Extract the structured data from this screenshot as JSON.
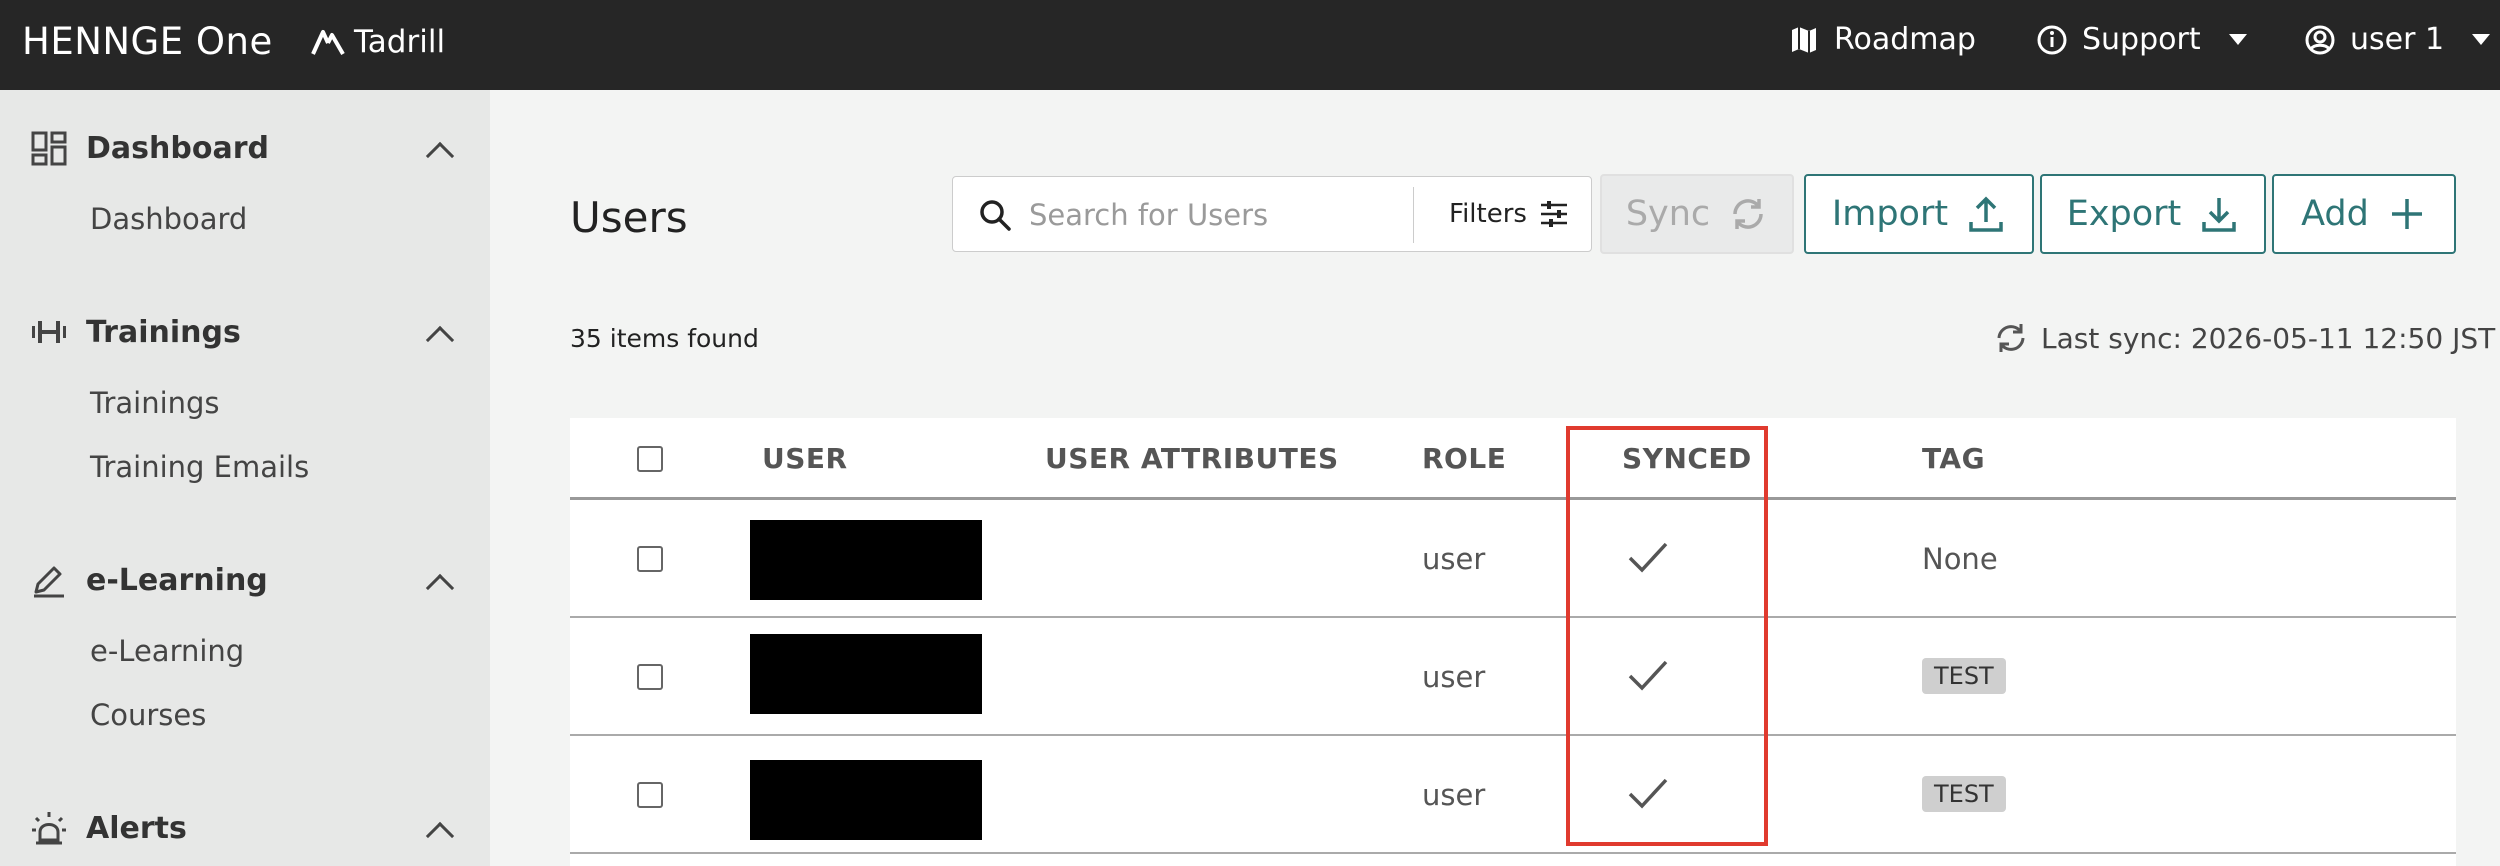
{
  "topbar": {
    "brand": "HENNGE One",
    "product": "Tadrill",
    "roadmap": "Roadmap",
    "support": "Support",
    "user": "user 1"
  },
  "sidebar": {
    "sections": [
      {
        "title": "Dashboard",
        "icon": "dashboard-icon",
        "items": [
          "Dashboard"
        ]
      },
      {
        "title": "Trainings",
        "icon": "dumbbell-icon",
        "items": [
          "Trainings",
          "Training Emails"
        ]
      },
      {
        "title": "e-Learning",
        "icon": "pencil-icon",
        "items": [
          "e-Learning",
          "Courses"
        ]
      },
      {
        "title": "Alerts",
        "icon": "alarm-light-icon",
        "items": []
      }
    ]
  },
  "main": {
    "title": "Users",
    "search_placeholder": "Search for Users",
    "filters_label": "Filters",
    "sync_label": "Sync",
    "import_label": "Import",
    "export_label": "Export",
    "add_label": "Add",
    "items_found": "35 items found",
    "last_sync": "Last sync: 2026-05-11 12:50 JST"
  },
  "table": {
    "headers": [
      "USER",
      "USER ATTRIBUTES",
      "ROLE",
      "SYNCED",
      "TAG"
    ],
    "rows": [
      {
        "user": "[redacted]",
        "attributes": "",
        "role": "user",
        "synced": true,
        "tag": "None"
      },
      {
        "user": "[redacted]",
        "attributes": "",
        "role": "user",
        "synced": true,
        "tag": "TEST"
      },
      {
        "user": "[redacted]",
        "attributes": "",
        "role": "user",
        "synced": true,
        "tag": "TEST"
      }
    ]
  },
  "colors": {
    "topbar": "#262626",
    "accent": "#2e7576",
    "highlight": "#e03a2e",
    "sidebar": "#e7e8e7"
  }
}
